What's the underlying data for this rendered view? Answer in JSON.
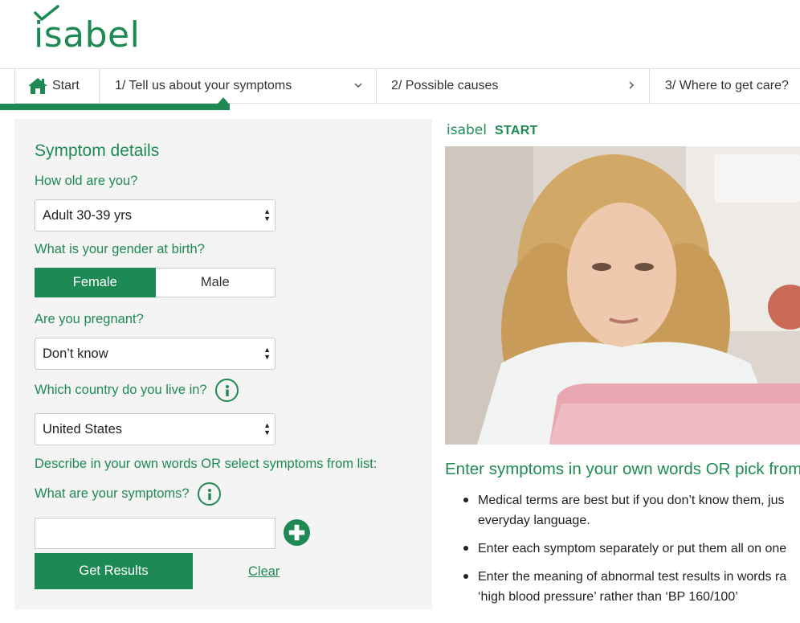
{
  "brand": {
    "logo_text": "isabel",
    "section_label": "START",
    "color": "#1e8a53"
  },
  "nav": {
    "start_label": "Start",
    "step1_label": "1/ Tell us about your symptoms",
    "step2_label": "2/ Possible causes",
    "step3_label": "3/ Where to get care?",
    "home_icon": "home-icon",
    "step1_chevron": "chevron-down-icon",
    "step2_chevron": "chevron-right-icon"
  },
  "form": {
    "title": "Symptom details",
    "age_question": "How old are you?",
    "age_value": "Adult 30-39 yrs",
    "gender_question": "What is your gender at birth?",
    "gender_options": [
      "Female",
      "Male"
    ],
    "gender_selected": "Female",
    "pregnant_question": "Are you pregnant?",
    "pregnant_value": "Don’t know",
    "country_question": "Which country do you live in?",
    "country_value": "United States",
    "describe_prompt": "Describe in your own words OR select symptoms from list:",
    "symptoms_question": "What are your symptoms?",
    "symptoms_value": "",
    "get_results_label": "Get Results",
    "clear_label": "Clear"
  },
  "info": {
    "heading": "Enter symptoms in your own words OR pick from",
    "bullets": [
      {
        "line1": "Medical terms are best but if you don’t know them, jus",
        "line2": "everyday language."
      },
      {
        "line1": "Enter each symptom separately or put them all on one",
        "line2": ""
      },
      {
        "line1": "Enter the meaning of abnormal test results in words ra",
        "line2": "‘high blood pressure’ rather than ‘BP 160/100’"
      }
    ]
  }
}
